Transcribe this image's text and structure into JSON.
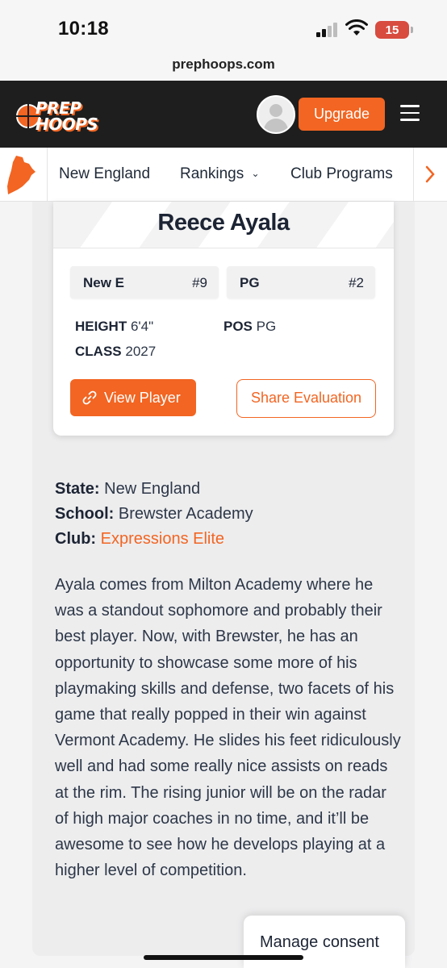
{
  "status_bar": {
    "time": "10:18",
    "battery": "15"
  },
  "browser": {
    "url": "prephoops.com"
  },
  "header": {
    "logo_line1": "PREP",
    "logo_line2": "HOOPS",
    "upgrade_label": "Upgrade"
  },
  "sub_nav": {
    "items": [
      {
        "label": "New England"
      },
      {
        "label": "Rankings",
        "chevron": "⌄"
      },
      {
        "label": "Club Programs"
      }
    ]
  },
  "player": {
    "name": "Reece Ayala",
    "rankings": [
      {
        "label": "New E",
        "rank": "#9"
      },
      {
        "label": "PG",
        "rank": "#2"
      }
    ],
    "stats": {
      "height_label": "HEIGHT",
      "height_value": "6'4\"",
      "class_label": "CLASS",
      "class_value": "2027",
      "pos_label": "POS",
      "pos_value": "PG"
    },
    "view_player_label": "View Player",
    "share_label": "Share Evaluation"
  },
  "details": {
    "state_label": "State:",
    "state_value": "New England",
    "school_label": "School:",
    "school_value": "Brewster Academy",
    "club_label": "Club:",
    "club_value": "Expressions Elite"
  },
  "evaluation": "Ayala comes from Milton Academy where he was a standout sophomore and probably their best player. Now, with Brewster, he has an opportunity to showcase some more of his playmaking skills and defense, two facets of his game that really popped in their win against Vermont Academy. He slides his feet ridiculously well and had some really nice assists on reads at the rim. The rising junior will be on the radar of high major coaches in no time, and it’ll be awesome to see how he develops playing at a higher level of competition.",
  "consent": {
    "label": "Manage consent"
  },
  "colors": {
    "brand_orange": "#f26522",
    "header_dark": "#1e1e1e"
  }
}
